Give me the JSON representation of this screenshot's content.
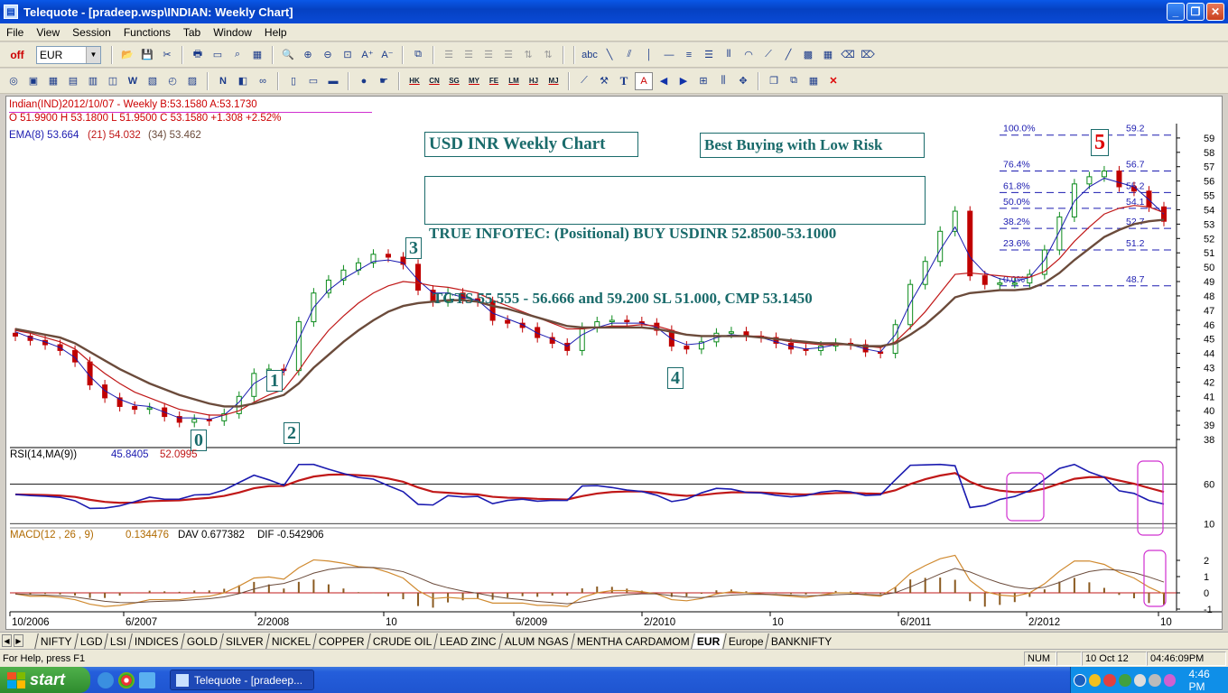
{
  "window": {
    "title": "Telequote - [pradeep.wsp\\INDIAN: Weekly Chart]"
  },
  "menu": [
    "File",
    "View",
    "Session",
    "Functions",
    "Tab",
    "Window",
    "Help"
  ],
  "toolbar": {
    "off_label": "off",
    "symbol_select": "EUR",
    "exchange_buttons": [
      "HK",
      "CN",
      "SG",
      "MY",
      "FE",
      "LM",
      "HJ",
      "MJ"
    ],
    "abc_label": "abc",
    "text_tool": "T",
    "font_tool": "A"
  },
  "chart_header": {
    "line1": "Indian(IND)2012/10/07   - Weekly B:53.1580 A:53.1730",
    "line2": "O 51.9900 H 53.1800 L 51.9500 C 53.1580 +1.308  +2.52%",
    "ema_label": "EMA(8) 53.664",
    "ema21": "(21) 54.032",
    "ema34": "(34) 53.462"
  },
  "annotations": {
    "title_box": "USD INR Weekly Chart",
    "subtitle_box": "Best Buying with Low Risk",
    "call_line1": "TRUE INFOTEC: (Positional) BUY USDINR 52.8500-53.1000",
    "call_line2": " TGTS 55.555 - 56.666 and 59.200 SL 51.000, CMP 53.1450"
  },
  "wave_labels": [
    "0",
    "1",
    "2",
    "3",
    "4",
    "5"
  ],
  "fib_levels": [
    {
      "pct": "100.0%",
      "price": "59.2",
      "value": 59.2
    },
    {
      "pct": "76.4%",
      "price": "56.7",
      "value": 56.7
    },
    {
      "pct": "61.8%",
      "price": "55.2",
      "value": 55.2
    },
    {
      "pct": "50.0%",
      "price": "54.1",
      "value": 54.1
    },
    {
      "pct": "38.2%",
      "price": "52.7",
      "value": 52.7
    },
    {
      "pct": "23.6%",
      "price": "51.2",
      "value": 51.2
    },
    {
      "pct": "0.0%",
      "price": "48.7",
      "value": 48.7
    }
  ],
  "rsi_header": {
    "label": "RSI(14,MA(9))",
    "rsi_value": "45.8405",
    "ma_value": "52.0995"
  },
  "macd_header": {
    "label": "MACD(12 , 26 , 9)",
    "macd_value": "0.134476",
    "dav": "DAV  0.677382",
    "dif": "DIF  -0.542906"
  },
  "chart_data": {
    "type": "line",
    "price_axis": {
      "ylim": [
        37.5,
        60
      ],
      "ticks": [
        38,
        39,
        40,
        41,
        42,
        43,
        44,
        45,
        46,
        47,
        48,
        49,
        50,
        51,
        52,
        53,
        54,
        55,
        56,
        57,
        58,
        59
      ]
    },
    "rsi_axis": {
      "ticks": [
        60,
        10
      ]
    },
    "macd_axis": {
      "ticks": [
        2,
        1,
        0,
        -1
      ]
    },
    "x_labels": [
      "10/2006",
      "6/2007",
      "2/2008",
      "10",
      "6/2009",
      "2/2010",
      "10",
      "6/2011",
      "2/2012",
      "10"
    ],
    "series": [
      {
        "name": "Close",
        "values": [
          45.2,
          44.9,
          44.6,
          44.2,
          43.4,
          41.8,
          40.9,
          40.3,
          40.1,
          40.2,
          39.6,
          39.2,
          39.4,
          39.3,
          39.8,
          41.0,
          42.6,
          42.9,
          42.8,
          46.2,
          48.2,
          49.1,
          49.8,
          50.3,
          50.9,
          50.7,
          50.2,
          48.4,
          47.6,
          48.2,
          47.8,
          47.6,
          46.3,
          46.1,
          45.8,
          45.1,
          44.7,
          44.2,
          45.8,
          46.2,
          46.3,
          46.2,
          46.1,
          45.6,
          44.5,
          44.3,
          44.8,
          45.4,
          45.5,
          45.2,
          45.1,
          44.7,
          44.3,
          44.2,
          44.5,
          44.7,
          44.6,
          44.1,
          44.0,
          46.0,
          48.8,
          50.4,
          52.5,
          53.9,
          49.4,
          48.8,
          48.9,
          48.9,
          49.5,
          51.2,
          53.5,
          55.8,
          56.3,
          56.7,
          55.6,
          55.3,
          54.2,
          53.2
        ]
      },
      {
        "name": "EMA(8)",
        "values": [
          45.5,
          45.1,
          44.8,
          44.4,
          43.7,
          42.4,
          41.4,
          40.8,
          40.4,
          40.3,
          39.9,
          39.5,
          39.5,
          39.4,
          39.7,
          40.6,
          41.9,
          42.5,
          42.7,
          45.0,
          47.2,
          48.4,
          49.2,
          49.8,
          50.4,
          50.5,
          50.3,
          49.1,
          48.2,
          48.2,
          47.9,
          47.7,
          46.8,
          46.4,
          46.0,
          45.4,
          45.0,
          44.5,
          45.3,
          45.8,
          46.1,
          46.1,
          46.1,
          45.8,
          45.0,
          44.6,
          44.7,
          45.1,
          45.3,
          45.2,
          45.1,
          44.8,
          44.5,
          44.3,
          44.4,
          44.6,
          44.6,
          44.3,
          44.1,
          45.3,
          47.5,
          49.3,
          51.2,
          52.8,
          50.7,
          49.6,
          49.2,
          49.0,
          49.3,
          50.5,
          52.5,
          54.6,
          55.6,
          56.2,
          55.9,
          55.6,
          54.7,
          53.7
        ]
      },
      {
        "name": "EMA(21)",
        "values": [
          45.6,
          45.4,
          45.1,
          44.8,
          44.3,
          43.4,
          42.6,
          41.9,
          41.3,
          40.9,
          40.5,
          40.1,
          39.9,
          39.7,
          39.7,
          40.0,
          40.6,
          41.1,
          41.5,
          42.8,
          44.3,
          45.6,
          46.6,
          47.5,
          48.2,
          48.7,
          49.0,
          48.9,
          48.7,
          48.6,
          48.4,
          48.2,
          47.7,
          47.3,
          46.9,
          46.5,
          46.1,
          45.7,
          45.7,
          45.8,
          45.9,
          45.9,
          46.0,
          45.9,
          45.6,
          45.3,
          45.2,
          45.2,
          45.2,
          45.2,
          45.2,
          45.0,
          44.8,
          44.7,
          44.6,
          44.6,
          44.6,
          44.5,
          44.4,
          44.8,
          45.8,
          46.9,
          48.2,
          49.5,
          49.6,
          49.5,
          49.4,
          49.3,
          49.3,
          49.7,
          50.6,
          51.8,
          52.8,
          53.7,
          54.1,
          54.3,
          54.2,
          53.8
        ]
      },
      {
        "name": "EMA(34)",
        "values": [
          45.7,
          45.5,
          45.3,
          45.1,
          44.7,
          44.1,
          43.5,
          42.9,
          42.4,
          41.9,
          41.5,
          41.1,
          40.8,
          40.5,
          40.3,
          40.3,
          40.5,
          40.8,
          41.1,
          41.9,
          43.0,
          43.9,
          44.8,
          45.6,
          46.3,
          46.9,
          47.3,
          47.5,
          47.6,
          47.7,
          47.7,
          47.6,
          47.3,
          47.1,
          46.8,
          46.5,
          46.2,
          45.9,
          45.8,
          45.8,
          45.8,
          45.8,
          45.8,
          45.7,
          45.5,
          45.3,
          45.2,
          45.2,
          45.2,
          45.2,
          45.1,
          45.0,
          44.9,
          44.8,
          44.7,
          44.7,
          44.6,
          44.5,
          44.5,
          44.7,
          45.3,
          46.0,
          46.9,
          47.9,
          48.2,
          48.3,
          48.4,
          48.4,
          48.5,
          48.9,
          49.6,
          50.5,
          51.3,
          52.1,
          52.6,
          53.0,
          53.2,
          53.3
        ]
      }
    ]
  },
  "tabs": [
    "NIFTY",
    "LGD",
    "LSI",
    "INDICES",
    "GOLD",
    "SILVER",
    "NICKEL",
    "COPPER",
    "CRUDE OIL",
    "LEAD ZINC",
    "ALUM NGAS",
    "MENTHA CARDAMOM",
    "EUR",
    "Europe",
    "BANKNIFTY"
  ],
  "active_tab": "EUR",
  "status": {
    "help": "For Help, press F1",
    "num": "NUM",
    "date": "10 Oct 12",
    "time": "04:46:09PM"
  },
  "taskbar": {
    "start": "start",
    "task_item": "Telequote - [pradeep...",
    "clock": "4:46 PM"
  },
  "colors": {
    "ema8": "#1b1bb0",
    "ema21": "#c01818",
    "ema34": "#6b4b3b",
    "up": "#0a8a1a",
    "down": "#c00000",
    "rsi": "#1b1bb0",
    "rsi_ma": "#c01818",
    "macd": "#d08a30",
    "fib": "#1b1bb0",
    "highlight": "#d030d0"
  }
}
